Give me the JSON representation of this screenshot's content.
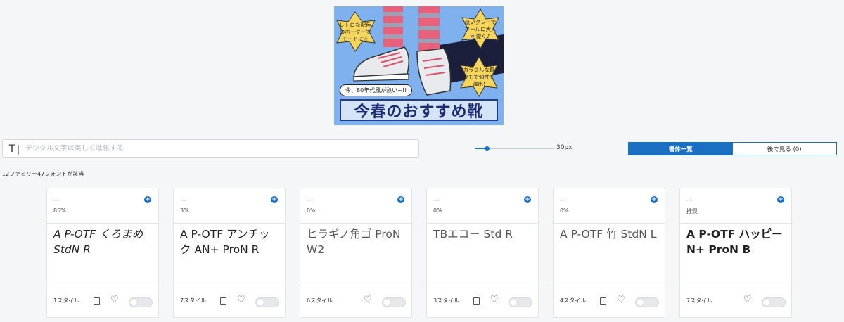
{
  "banner": {
    "title": "今春のおすすめ靴",
    "bubble": "今、80年代風が熱い~!!",
    "star_left": "レトロな配色のボーダーでモードに☆",
    "star_right_top": "淡いグレーでクールに大人可愛く♪",
    "star_right_bottom": "カラフルな靴ひもで個性を演出!"
  },
  "search": {
    "icon": "T",
    "placeholder": "デジタル文字は美しく進化する"
  },
  "size": {
    "value": 30,
    "min": 10,
    "max": 150,
    "label": "30px"
  },
  "tabs": [
    {
      "label": "書体一覧",
      "active": true
    },
    {
      "label": "後で見る (0)",
      "active": false
    }
  ],
  "result_count": "12ファミリー47フォントが該当",
  "cards": [
    {
      "name": "---",
      "meta": "85%",
      "sample": "A P-OTF くろまめ StdN R",
      "styles": "1スタイル",
      "file_icon": true
    },
    {
      "name": "---",
      "meta": "3%",
      "sample": "A P-OTF アンチック AN+ ProN R",
      "styles": "7スタイル",
      "file_icon": true
    },
    {
      "name": "---",
      "meta": "0%",
      "sample": "ヒラギノ角ゴ ProN W2",
      "styles": "6スタイル",
      "file_icon": false
    },
    {
      "name": "---",
      "meta": "0%",
      "sample": "TBエコー Std R",
      "styles": "3スタイル",
      "file_icon": true
    },
    {
      "name": "---",
      "meta": "0%",
      "sample": "A P-OTF 竹 StdN L",
      "styles": "4スタイル",
      "file_icon": true
    },
    {
      "name": "---",
      "meta": "推奨",
      "sample": "A P-OTF ハッピー N+ ProN B",
      "styles": "7スタイル",
      "file_icon": false
    }
  ],
  "icons": {
    "add": "plus-circle-icon",
    "file": "file-icon",
    "favorite": "heart-icon"
  },
  "colors": {
    "accent": "#1a6fc3",
    "background": "#f5f6f8"
  }
}
